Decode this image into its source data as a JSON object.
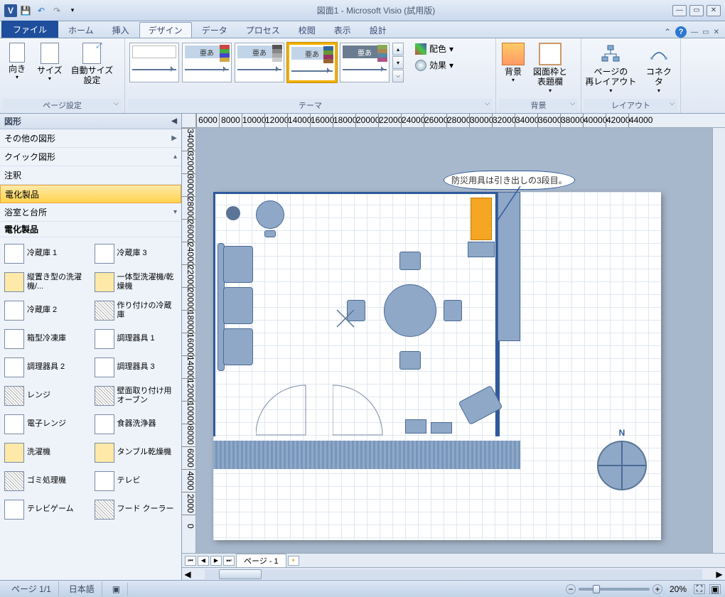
{
  "title": "図面1 - Microsoft Visio (試用版)",
  "qat": {
    "save": "保存",
    "undo": "元に戻す",
    "redo": "やり直し"
  },
  "tabs": {
    "file": "ファイル",
    "home": "ホーム",
    "insert": "挿入",
    "design": "デザイン",
    "data": "データ",
    "process": "プロセス",
    "review": "校閲",
    "view": "表示",
    "plan": "設計"
  },
  "ribbon": {
    "page_setup": {
      "label": "ページ設定",
      "orientation": "向き",
      "size": "サイズ",
      "autosize": "自動サイズ\n設定"
    },
    "themes": {
      "label": "テーマ",
      "sample": "亜あ",
      "colors": "配色",
      "effects": "効果"
    },
    "background": {
      "label": "背景",
      "bg": "背景",
      "border": "図面枠と\n表題欄"
    },
    "layout": {
      "label": "レイアウト",
      "relayout": "ページの\n再レイアウト",
      "connectors": "コネクタ"
    }
  },
  "shapes": {
    "title": "図形",
    "more": "その他の図形",
    "quick": "クイック図形",
    "annotation": "注釈",
    "appliances": "電化製品",
    "bath": "浴室と台所",
    "section": "電化製品",
    "items": [
      {
        "name": "冷蔵庫 1",
        "style": ""
      },
      {
        "name": "冷蔵庫 3",
        "style": ""
      },
      {
        "name": "縦置き型の洗濯機/...",
        "style": "yellow"
      },
      {
        "name": "一体型洗濯機/乾燥機",
        "style": "yellow"
      },
      {
        "name": "冷蔵庫 2",
        "style": ""
      },
      {
        "name": "作り付けの冷蔵庫",
        "style": "hatch"
      },
      {
        "name": "箱型冷凍庫",
        "style": ""
      },
      {
        "name": "調理器具 1",
        "style": ""
      },
      {
        "name": "調理器具 2",
        "style": ""
      },
      {
        "name": "調理器具 3",
        "style": ""
      },
      {
        "name": "レンジ",
        "style": "hatch"
      },
      {
        "name": "壁面取り付け用オーブン",
        "style": "hatch"
      },
      {
        "name": "電子レンジ",
        "style": ""
      },
      {
        "name": "食器洗浄器",
        "style": ""
      },
      {
        "name": "洗濯機",
        "style": "yellow"
      },
      {
        "name": "タンブル乾燥機",
        "style": "yellow"
      },
      {
        "name": "ゴミ処理機",
        "style": "hatch"
      },
      {
        "name": "テレビ",
        "style": ""
      },
      {
        "name": "テレビゲーム",
        "style": ""
      },
      {
        "name": "フード クーラー",
        "style": "hatch"
      }
    ]
  },
  "drawing": {
    "callout": "防災用具は引き出しの3段目。",
    "compass": "N"
  },
  "ruler_h": [
    "6000",
    "8000",
    "10000",
    "12000",
    "14000",
    "16000",
    "18000",
    "20000",
    "22000",
    "24000",
    "26000",
    "28000",
    "30000",
    "32000",
    "34000",
    "36000",
    "38000",
    "40000",
    "42000",
    "44000"
  ],
  "ruler_v": [
    "34000",
    "32000",
    "30000",
    "28000",
    "26000",
    "24000",
    "22000",
    "20000",
    "18000",
    "16000",
    "14000",
    "12000",
    "10000",
    "8000",
    "6000",
    "4000",
    "2000",
    "0"
  ],
  "page_tab": "ページ - 1",
  "status": {
    "page": "ページ 1/1",
    "lang": "日本語",
    "zoom": "20%"
  }
}
